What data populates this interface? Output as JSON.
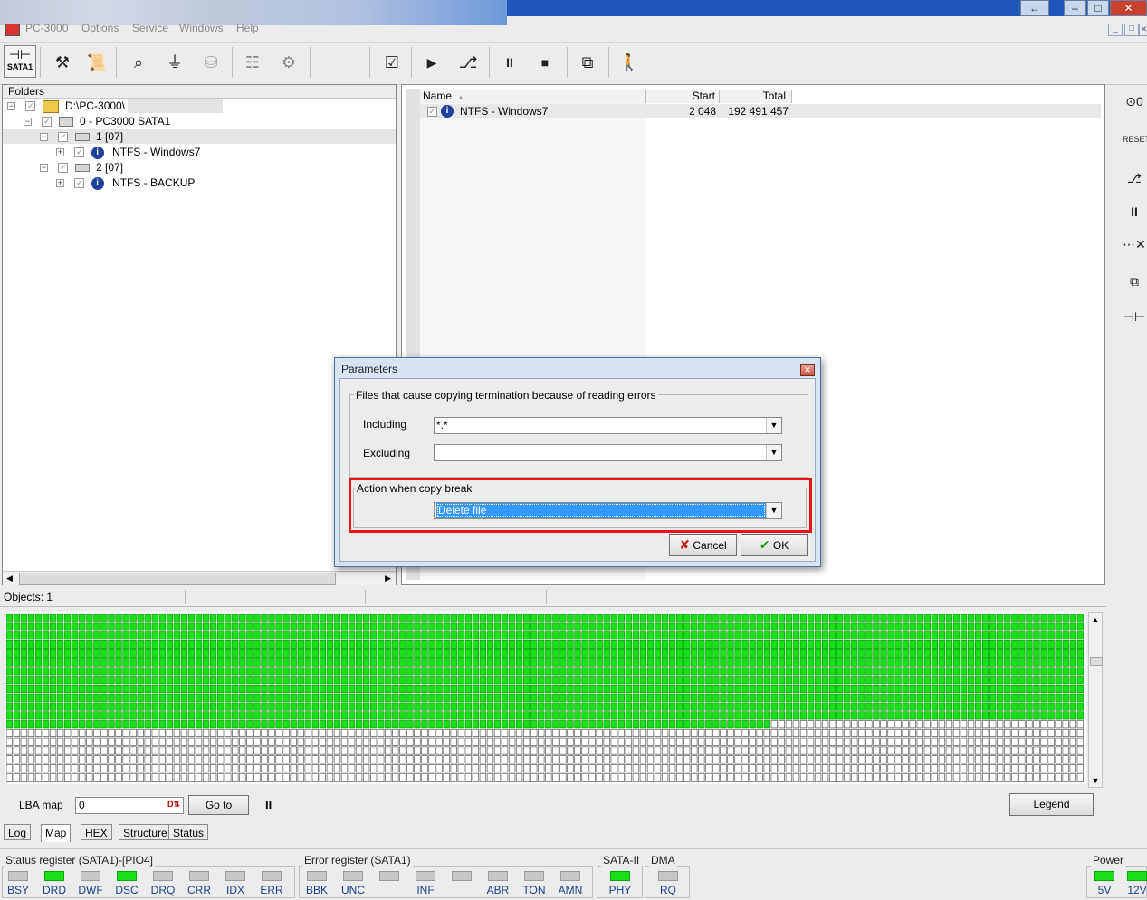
{
  "app": {
    "title": "PC-3000",
    "menu": [
      "Options",
      "Service",
      "Windows",
      "Help"
    ],
    "window_controls": [
      "↔",
      "–",
      "□",
      "✕"
    ],
    "mdi_controls": [
      "_",
      "□",
      "✕"
    ]
  },
  "toolbar": {
    "sata_label": "SATA1"
  },
  "folders_panel": {
    "title": "Folders",
    "tree": [
      {
        "label": "D:\\PC-3000\\",
        "level": 0
      },
      {
        "label": "0 - PC3000 SATA1",
        "level": 1
      },
      {
        "label": "1 [07]",
        "level": 2
      },
      {
        "label": "NTFS - Windows7",
        "level": 3
      },
      {
        "label": "2 [07]",
        "level": 2
      },
      {
        "label": "NTFS - BACKUP",
        "level": 3
      }
    ],
    "objects_label": "Objects: 1"
  },
  "list_panel": {
    "columns": [
      "Name",
      "Start",
      "Total"
    ],
    "rows": [
      {
        "name": "NTFS - Windows7",
        "start": "2 048",
        "total": "192 491 457"
      }
    ]
  },
  "map": {
    "lba_label": "LBA map",
    "lba_value": "0",
    "goto_label": "Go to",
    "pause_label": "II",
    "legend_label": "Legend",
    "filled_rows": 12,
    "partial_row_cells": 105,
    "total_rows": 19,
    "green": "#19e019"
  },
  "bottom_tabs": [
    "Log",
    "Map",
    "HEX",
    "Structure",
    "Status"
  ],
  "status_register": {
    "title": "Status register (SATA1)-[PIO4]",
    "leds": [
      {
        "label": "BSY",
        "on": false
      },
      {
        "label": "DRD",
        "on": true
      },
      {
        "label": "DWF",
        "on": false
      },
      {
        "label": "DSC",
        "on": true
      },
      {
        "label": "DRQ",
        "on": false
      },
      {
        "label": "CRR",
        "on": false
      },
      {
        "label": "IDX",
        "on": false
      },
      {
        "label": "ERR",
        "on": false
      }
    ]
  },
  "error_register": {
    "title": "Error register (SATA1)",
    "leds": [
      {
        "label": "BBK",
        "on": false
      },
      {
        "label": "UNC",
        "on": false
      },
      {
        "label": "",
        "on": false
      },
      {
        "label": "INF",
        "on": false
      },
      {
        "label": "",
        "on": false
      },
      {
        "label": "ABR",
        "on": false
      },
      {
        "label": "TON",
        "on": false
      },
      {
        "label": "AMN",
        "on": false
      }
    ]
  },
  "sata2": {
    "title": "SATA-II",
    "led": {
      "label": "PHY",
      "on": true
    }
  },
  "dma": {
    "title": "DMA",
    "led": {
      "label": "RQ",
      "on": false
    }
  },
  "power": {
    "title": "Power",
    "leds": [
      {
        "label": "5V",
        "on": true
      },
      {
        "label": "12V",
        "on": true
      }
    ]
  },
  "dialog": {
    "title": "Parameters",
    "group1_title": "Files that cause copying termination because of reading errors",
    "including_label": "Including",
    "including_value": "*.*",
    "excluding_label": "Excluding",
    "excluding_value": "",
    "group2_title": "Action when copy break",
    "action_value": "Delete file",
    "cancel_label": "Cancel",
    "ok_label": "OK"
  },
  "colors": {
    "highlight_red": "#e8121b",
    "selection_blue": "#3399ff",
    "titlebar_blue": "#1f56b8"
  }
}
